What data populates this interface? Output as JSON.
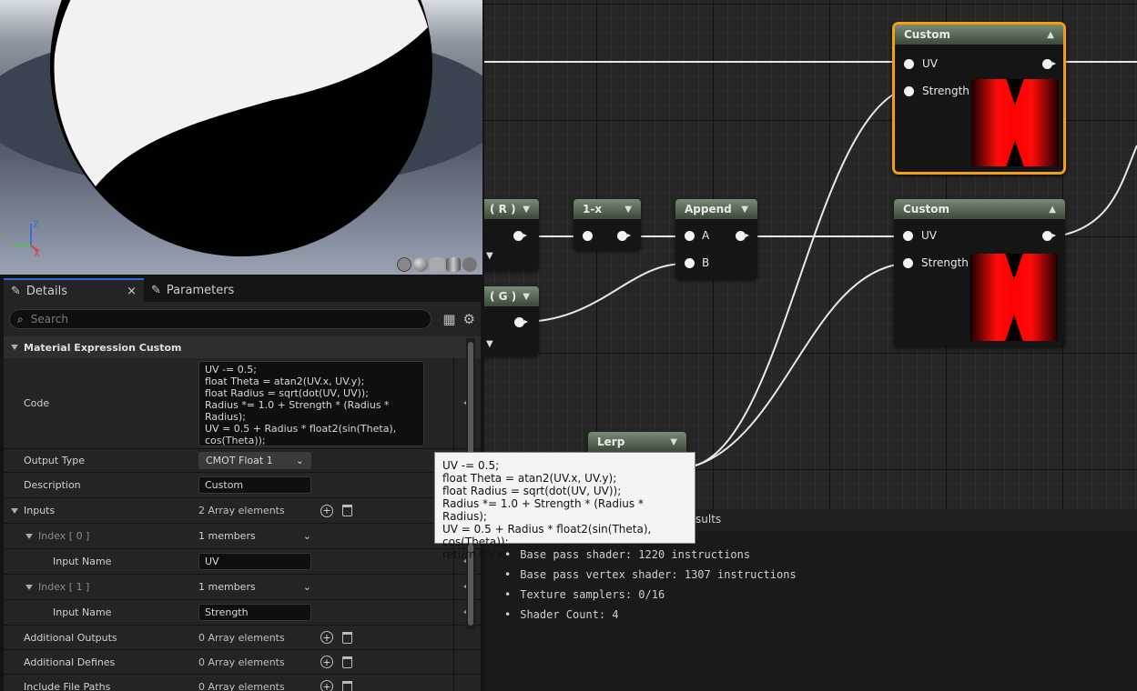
{
  "viewport": {
    "preview_buttons": [
      "grid-sphere-icon",
      "sphere-icon",
      "plane-icon",
      "cylinder-icon",
      "custom-mesh-icon"
    ]
  },
  "graph": {
    "nodes": {
      "r_label": "( R )",
      "g_label": "( G )",
      "oneminus": "1-x",
      "append": "Append",
      "lerp": "Lerp",
      "custom_top": {
        "title": "Custom",
        "pins": [
          "UV",
          "Strength"
        ]
      },
      "custom_mid": {
        "title": "Custom",
        "pins": [
          "UV",
          "Strength"
        ]
      },
      "append_pins": [
        "A",
        "B"
      ]
    }
  },
  "details": {
    "tabs": [
      {
        "label": "Details"
      },
      {
        "label": "Parameters"
      }
    ],
    "search_placeholder": "Search",
    "category": "Material Expression Custom",
    "code_label": "Code",
    "code": "UV -= 0.5;\nfloat Theta = atan2(UV.x, UV.y);\nfloat Radius = sqrt(dot(UV, UV));\nRadius *= 1.0 + Strength * (Radius * Radius);\nUV = 0.5 + Radius * float2(sin(Theta), cos(Theta));\nreturn UV.x;",
    "output_type_label": "Output Type",
    "output_type": "CMOT Float 1",
    "description_label": "Description",
    "description": "Custom",
    "inputs_label": "Inputs",
    "inputs_count": "2 Array elements",
    "index0_label": "Index [ 0 ]",
    "index0_members": "1 members",
    "input_name_label": "Input Name",
    "index0_name": "UV",
    "index1_label": "Index [ 1 ]",
    "index1_members": "1 members",
    "index1_name": "Strength",
    "additional_outputs_label": "Additional Outputs",
    "additional_outputs": "0 Array elements",
    "additional_defines_label": "Additional Defines",
    "additional_defines": "0 Array elements",
    "include_paths_label": "Include File Paths",
    "include_paths": "0 Array elements"
  },
  "tooltip": "UV -= 0.5;\nfloat Theta = atan2(UV.x, UV.y);\nfloat Radius = sqrt(dot(UV, UV));\nRadius *= 1.0 + Strength * (Radius * Radius);\nUV = 0.5 + Radius * float2(sin(Theta), cos(Theta));\nreturn UV.x;",
  "results": {
    "tab_partial": "sults",
    "stats": [
      "Base pass shader: 1220 instructions",
      "Base pass vertex shader: 1307 instructions",
      "Texture samplers: 0/16",
      "Shader Count: 4"
    ]
  }
}
